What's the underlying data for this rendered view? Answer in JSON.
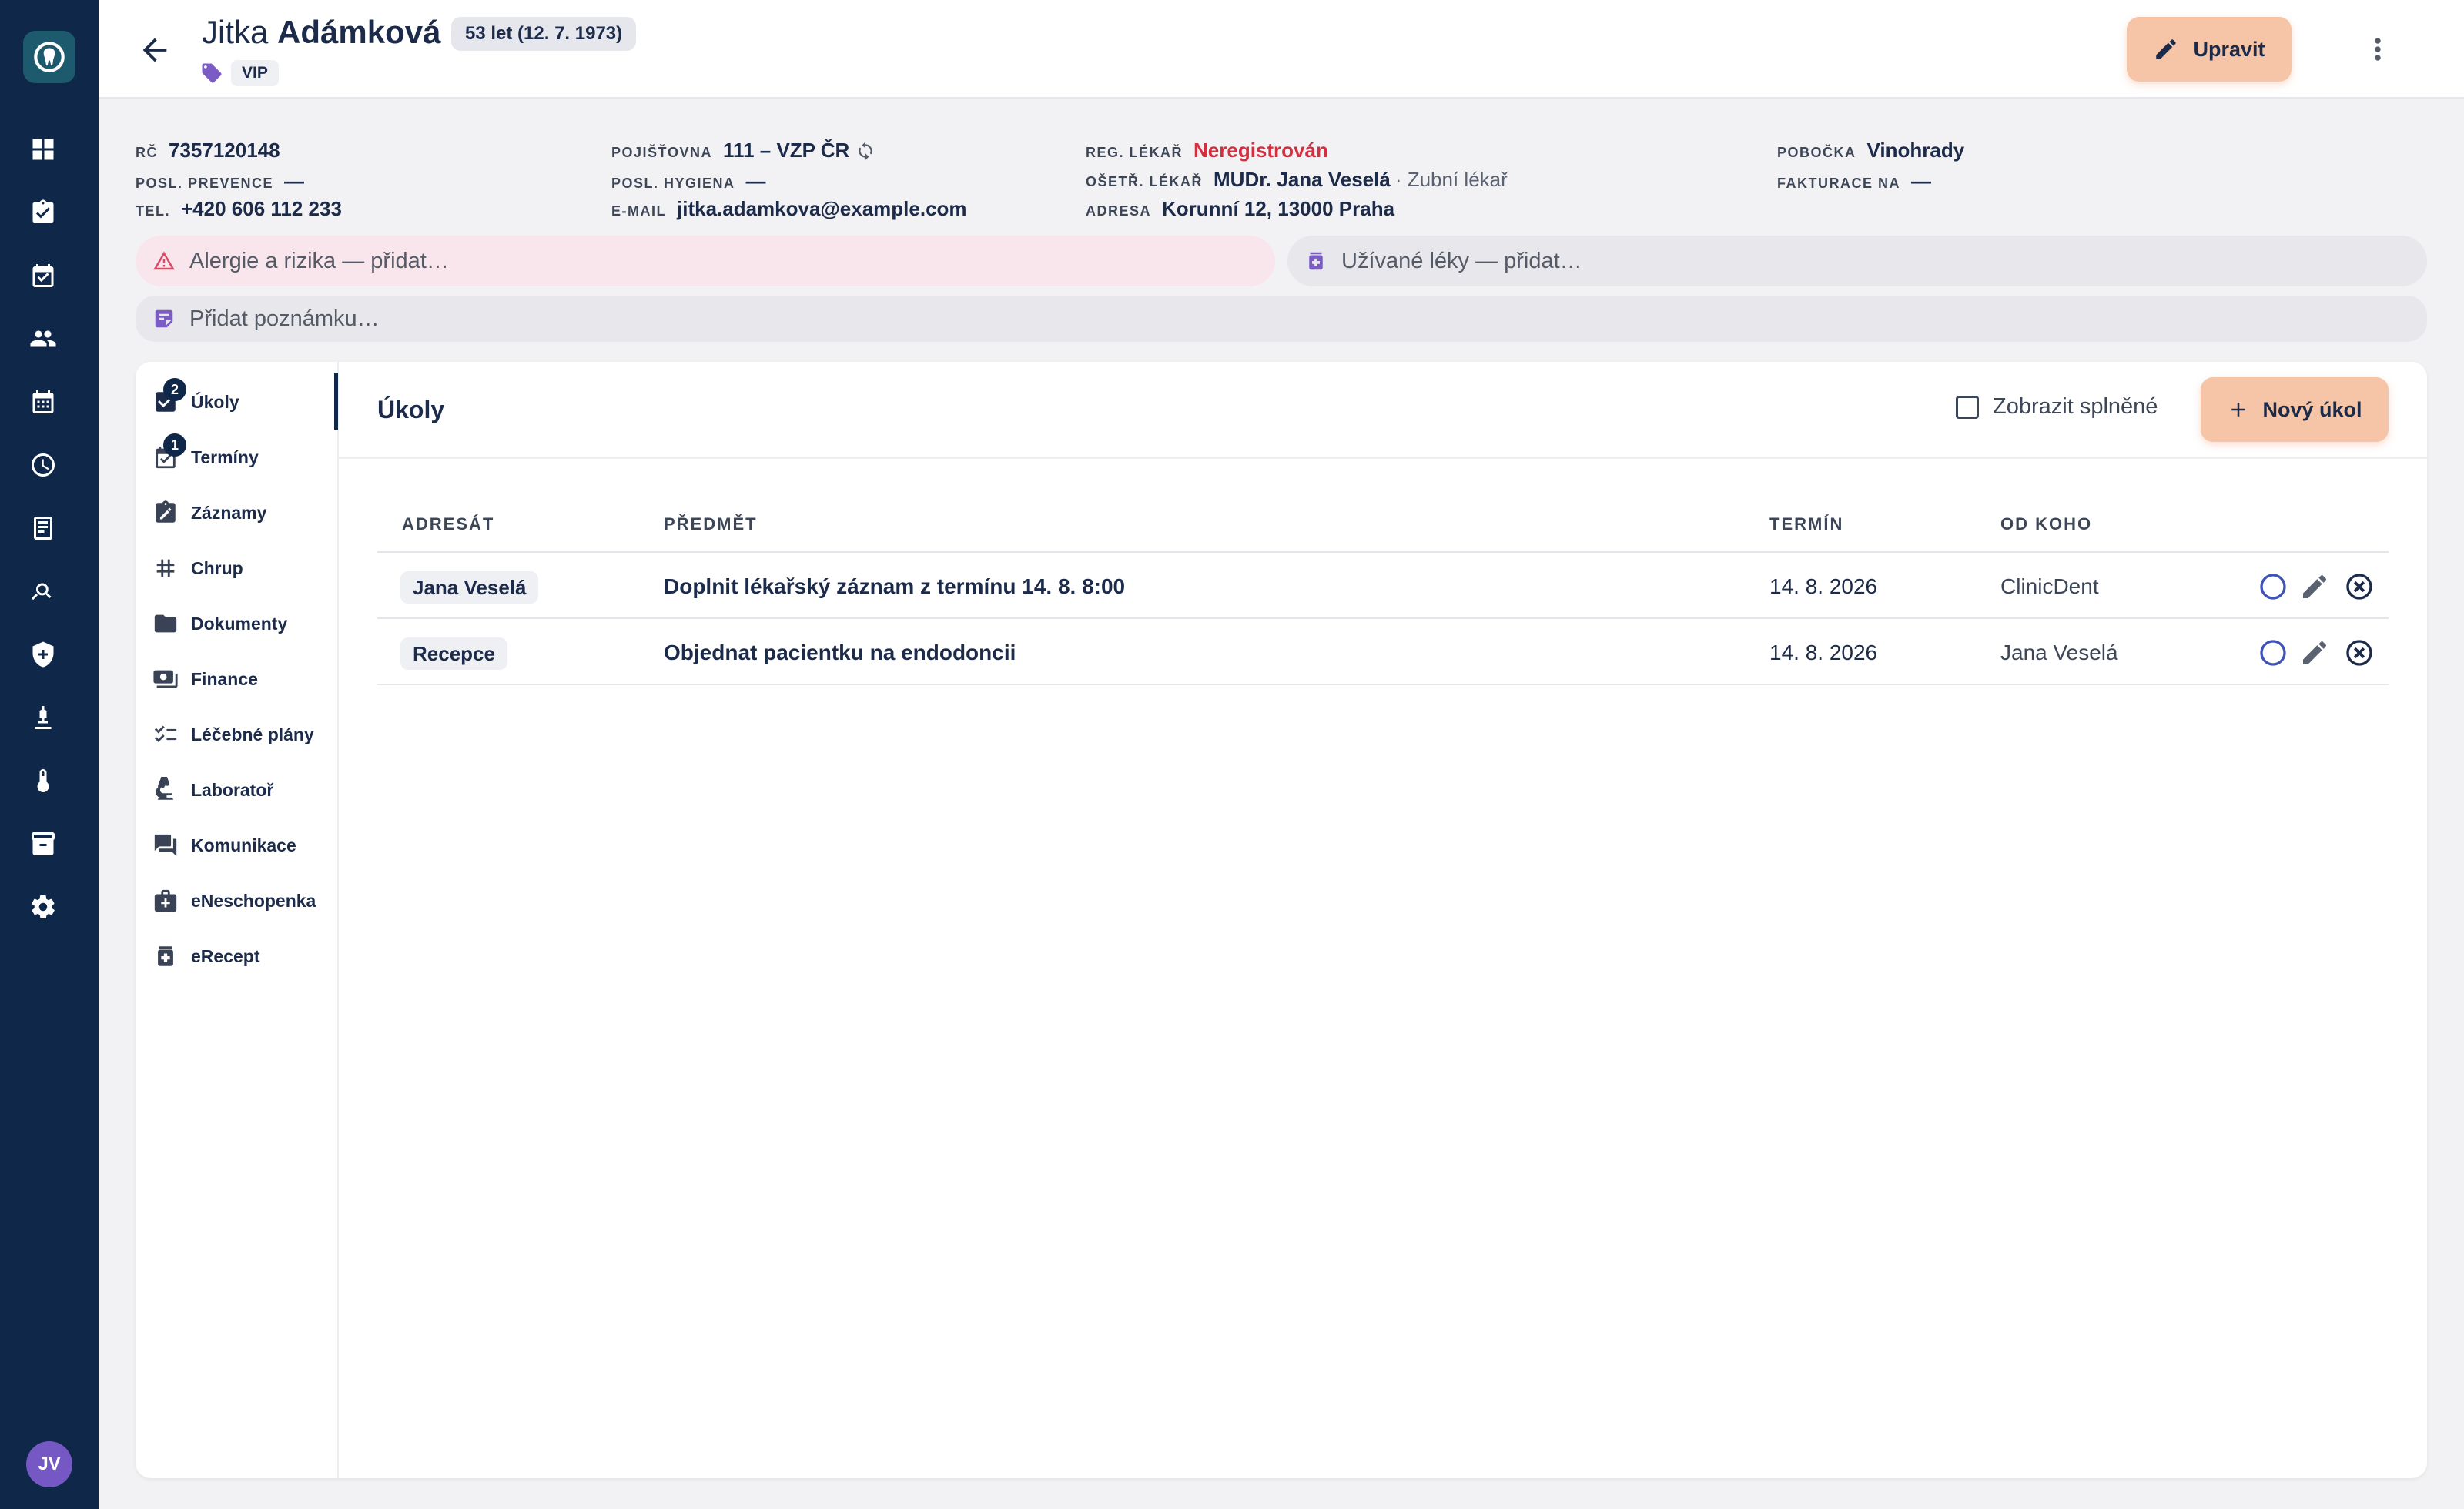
{
  "colors": {
    "rail_bg": "#0f2748",
    "accent_button": "#f6c4a6",
    "danger_text": "#d32f3f",
    "avatar_bg": "#7658c4",
    "tag_icon": "#7b5cc4",
    "allergy_pill_bg": "#f8e6ec"
  },
  "rail": {
    "logo_icon": "tooth-logo-icon",
    "items": [
      {
        "icon": "dashboard-icon"
      },
      {
        "icon": "clipboard-check-icon"
      },
      {
        "icon": "calendar-check-icon"
      },
      {
        "icon": "patients-icon"
      },
      {
        "icon": "calendar-grid-icon"
      },
      {
        "icon": "clock-icon"
      },
      {
        "icon": "receipt-icon"
      },
      {
        "icon": "analytics-icon"
      },
      {
        "icon": "shield-icon"
      },
      {
        "icon": "microscope-icon"
      },
      {
        "icon": "thermometer-icon"
      },
      {
        "icon": "archive-icon"
      },
      {
        "icon": "settings-icon"
      }
    ],
    "avatar_initials": "JV"
  },
  "header": {
    "first_name": "Jitka",
    "last_name": "Adámková",
    "age_badge": "53 let (12. 7. 1973)",
    "tag": "VIP",
    "edit_label": "Upravit"
  },
  "info": {
    "rc_label": "RČ",
    "rc_value": "7357120148",
    "prevention_label": "POSL. PREVENCE",
    "prevention_value": "—",
    "phone_label": "TEL.",
    "phone_value": "+420 606 112 233",
    "insurance_label": "POJIŠŤOVNA",
    "insurance_value": "111 – VZP ČR",
    "hygiene_label": "POSL. HYGIENA",
    "hygiene_value": "—",
    "email_label": "E-MAIL",
    "email_value": "jitka.adamkova@example.com",
    "reg_label": "REG. LÉKAŘ",
    "reg_value": "Neregistrován",
    "doctor_label": "OŠETŘ. LÉKAŘ",
    "doctor_value": "MUDr. Jana Veselá",
    "doctor_role": "· Zubní lékař",
    "address_label": "ADRESA",
    "address_value": "Korunní 12, 13000 Praha",
    "branch_label": "POBOČKA",
    "branch_value": "Vinohrady",
    "billing_label": "FAKTURACE NA",
    "billing_value": "—"
  },
  "pills": {
    "allergy": "Alergie a rizika — přidat…",
    "meds": "Užívané léky — přidat…",
    "note": "Přidat poznámku…"
  },
  "subnav": {
    "items": [
      {
        "label": "Úkoly",
        "icon": "task-check-icon",
        "badge": "2"
      },
      {
        "label": "Termíny",
        "icon": "appointment-icon",
        "badge": "1"
      },
      {
        "label": "Záznamy",
        "icon": "record-edit-icon"
      },
      {
        "label": "Chrup",
        "icon": "dentition-grid-icon"
      },
      {
        "label": "Dokumenty",
        "icon": "folder-icon"
      },
      {
        "label": "Finance",
        "icon": "money-icon"
      },
      {
        "label": "Léčebné plány",
        "icon": "checklist-icon"
      },
      {
        "label": "Laboratoř",
        "icon": "lab-microscope-icon"
      },
      {
        "label": "Komunikace",
        "icon": "chat-icon"
      },
      {
        "label": "eNeschopenka",
        "icon": "medical-bag-icon"
      },
      {
        "label": "eRecept",
        "icon": "prescription-icon"
      }
    ]
  },
  "tasks": {
    "title": "Úkoly",
    "show_done_label": "Zobrazit splněné",
    "new_label": "Nový úkol",
    "columns": [
      "ADRESÁT",
      "PŘEDMĚT",
      "TERMÍN",
      "OD KOHO"
    ],
    "rows": [
      {
        "addressee": "Jana Veselá",
        "subject": "Doplnit lékařský záznam z termínu 14. 8. 8:00",
        "due": "14. 8. 2026",
        "from": "ClinicDent"
      },
      {
        "addressee": "Recepce",
        "subject": "Objednat pacientku na endodoncii",
        "due": "14. 8. 2026",
        "from": "Jana Veselá"
      }
    ]
  }
}
